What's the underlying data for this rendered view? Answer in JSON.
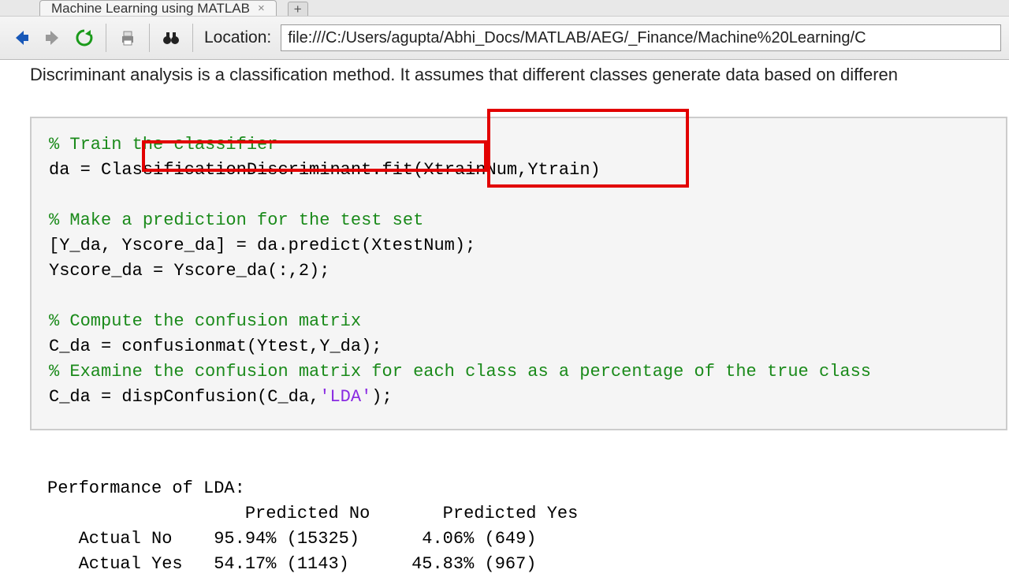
{
  "tab": {
    "title": "Machine Learning using MATLAB"
  },
  "location": {
    "label": "Location:",
    "url": "file:///C:/Users/agupta/Abhi_Docs/MATLAB/AEG/_Finance/Machine%20Learning/C"
  },
  "intro": "Discriminant analysis is a classification method. It assumes that different classes generate data based on differen",
  "code": {
    "c1": "% Train the classifier",
    "l1a": "da = ",
    "l1b": "ClassificationDiscriminant.fit",
    "l1c": "(XtrainNum,Ytrain)",
    "c2": "% Make a prediction for the test set",
    "l2": "[Y_da, Yscore_da] = da.predict(XtestNum);",
    "l3": "Yscore_da = Yscore_da(:,2);",
    "c3": "% Compute the confusion matrix",
    "l4": "C_da = confusionmat(Ytest,Y_da);",
    "c4": "% Examine the confusion matrix for each class as a percentage of the true class",
    "l5a": "C_da = dispConfusion(C_da,",
    "l5b": "'LDA'",
    "l5c": ");"
  },
  "output": {
    "title": "Performance of LDA:",
    "header": "                   Predicted No       Predicted Yes",
    "row1": "   Actual No    95.94% (15325)      4.06% (649)",
    "row2": "   Actual Yes   54.17% (1143)      45.83% (967)"
  }
}
